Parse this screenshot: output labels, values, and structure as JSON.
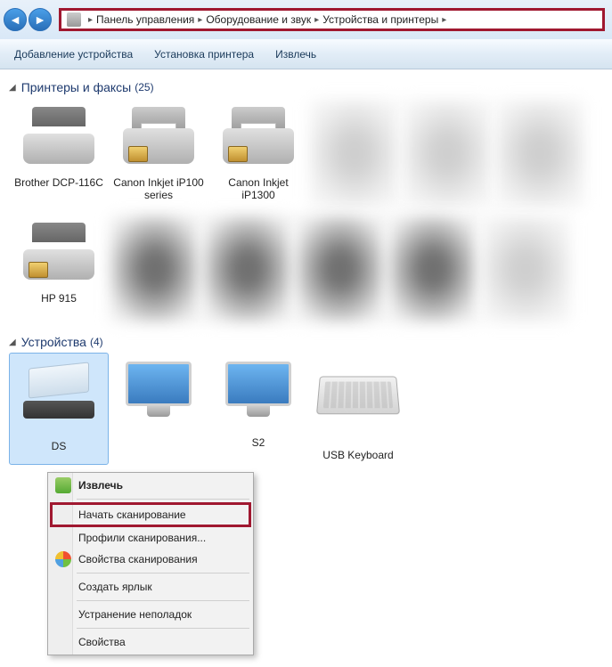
{
  "breadcrumb": {
    "items": [
      "Панель управления",
      "Оборудование и звук",
      "Устройства и принтеры"
    ]
  },
  "toolbar": {
    "add_device": "Добавление устройства",
    "add_printer": "Установка принтера",
    "eject": "Извлечь"
  },
  "groups": {
    "printers": {
      "title": "Принтеры и факсы",
      "count": "(25)"
    },
    "devices": {
      "title": "Устройства",
      "count": "(4)"
    }
  },
  "printers": [
    {
      "name": "Brother DCP-116C"
    },
    {
      "name": "Canon Inkjet iP100 series"
    },
    {
      "name": "Canon Inkjet iP1300"
    },
    {
      "name": "HP 915"
    }
  ],
  "devices": [
    {
      "name": "DS"
    },
    {
      "name": ""
    },
    {
      "name": "S2"
    },
    {
      "name": "USB Keyboard"
    }
  ],
  "context_menu": {
    "eject": "Извлечь",
    "start_scan": "Начать сканирование",
    "scan_profiles": "Профили сканирования...",
    "scan_properties": "Свойства сканирования",
    "create_shortcut": "Создать ярлык",
    "troubleshoot": "Устранение неполадок",
    "properties": "Свойства"
  }
}
